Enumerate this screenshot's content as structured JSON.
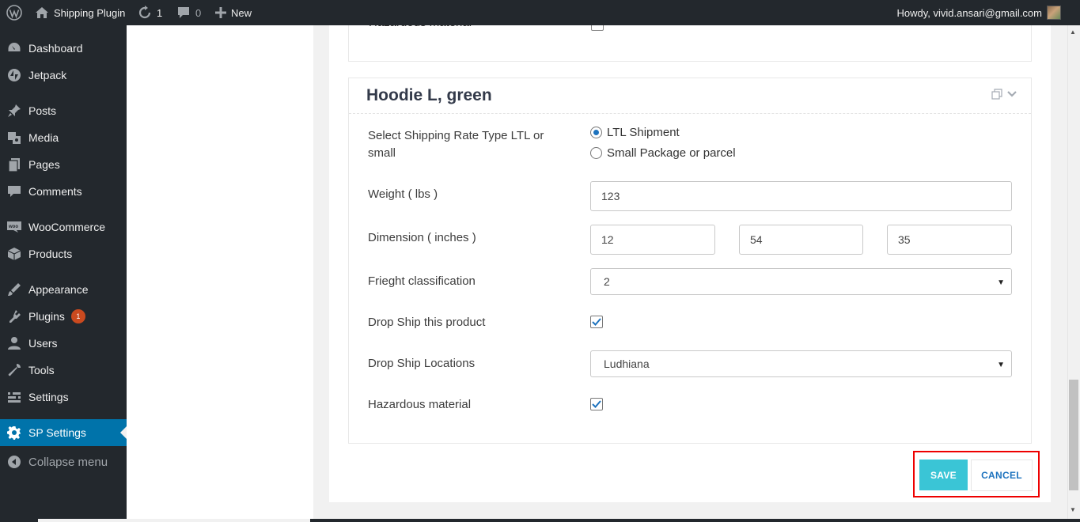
{
  "adminbar": {
    "site_name": "Shipping Plugin",
    "updates_count": "1",
    "comments_count": "0",
    "new_label": "New",
    "howdy": "Howdy, vivid.ansari@gmail.com"
  },
  "menu": {
    "items": [
      {
        "label": "Dashboard",
        "icon": "dashboard-icon"
      },
      {
        "label": "Jetpack",
        "icon": "jetpack-icon"
      },
      {
        "label": "Posts",
        "icon": "pin-icon"
      },
      {
        "label": "Media",
        "icon": "media-icon"
      },
      {
        "label": "Pages",
        "icon": "pages-icon"
      },
      {
        "label": "Comments",
        "icon": "comments-icon"
      },
      {
        "label": "WooCommerce",
        "icon": "woocommerce-icon"
      },
      {
        "label": "Products",
        "icon": "products-icon"
      },
      {
        "label": "Appearance",
        "icon": "appearance-icon"
      },
      {
        "label": "Plugins",
        "icon": "plugins-icon",
        "badge": "1"
      },
      {
        "label": "Users",
        "icon": "users-icon"
      },
      {
        "label": "Tools",
        "icon": "tools-icon"
      },
      {
        "label": "Settings",
        "icon": "settings-icon"
      },
      {
        "label": "SP Settings",
        "icon": "gear-icon",
        "current": true
      }
    ],
    "collapse_label": "Collapse menu"
  },
  "previous_panel": {
    "partial_label": "Hazardous material"
  },
  "product": {
    "title": "Hoodie L, green",
    "rate_type_label": "Select Shipping Rate Type LTL or small",
    "rate_options": [
      {
        "label": "LTL Shipment",
        "checked": true
      },
      {
        "label": "Small Package or parcel",
        "checked": false
      }
    ],
    "weight_label": "Weight ( lbs )",
    "weight_value": "123",
    "dimension_label": "Dimension ( inches )",
    "dimension_values": [
      "12",
      "54",
      "35"
    ],
    "freight_label": "Frieght classification",
    "freight_value": "2",
    "drop_ship_label": "Drop Ship this product",
    "drop_ship_checked": true,
    "drop_ship_locations_label": "Drop Ship Locations",
    "drop_ship_location_value": "Ludhiana",
    "hazardous_label": "Hazardous material",
    "hazardous_checked": true
  },
  "actions": {
    "save_label": "SAVE",
    "cancel_label": "CANCEL"
  },
  "colors": {
    "accent": "#3ac5d6",
    "wp_blue": "#0073aa",
    "highlight": "#ee0000"
  }
}
